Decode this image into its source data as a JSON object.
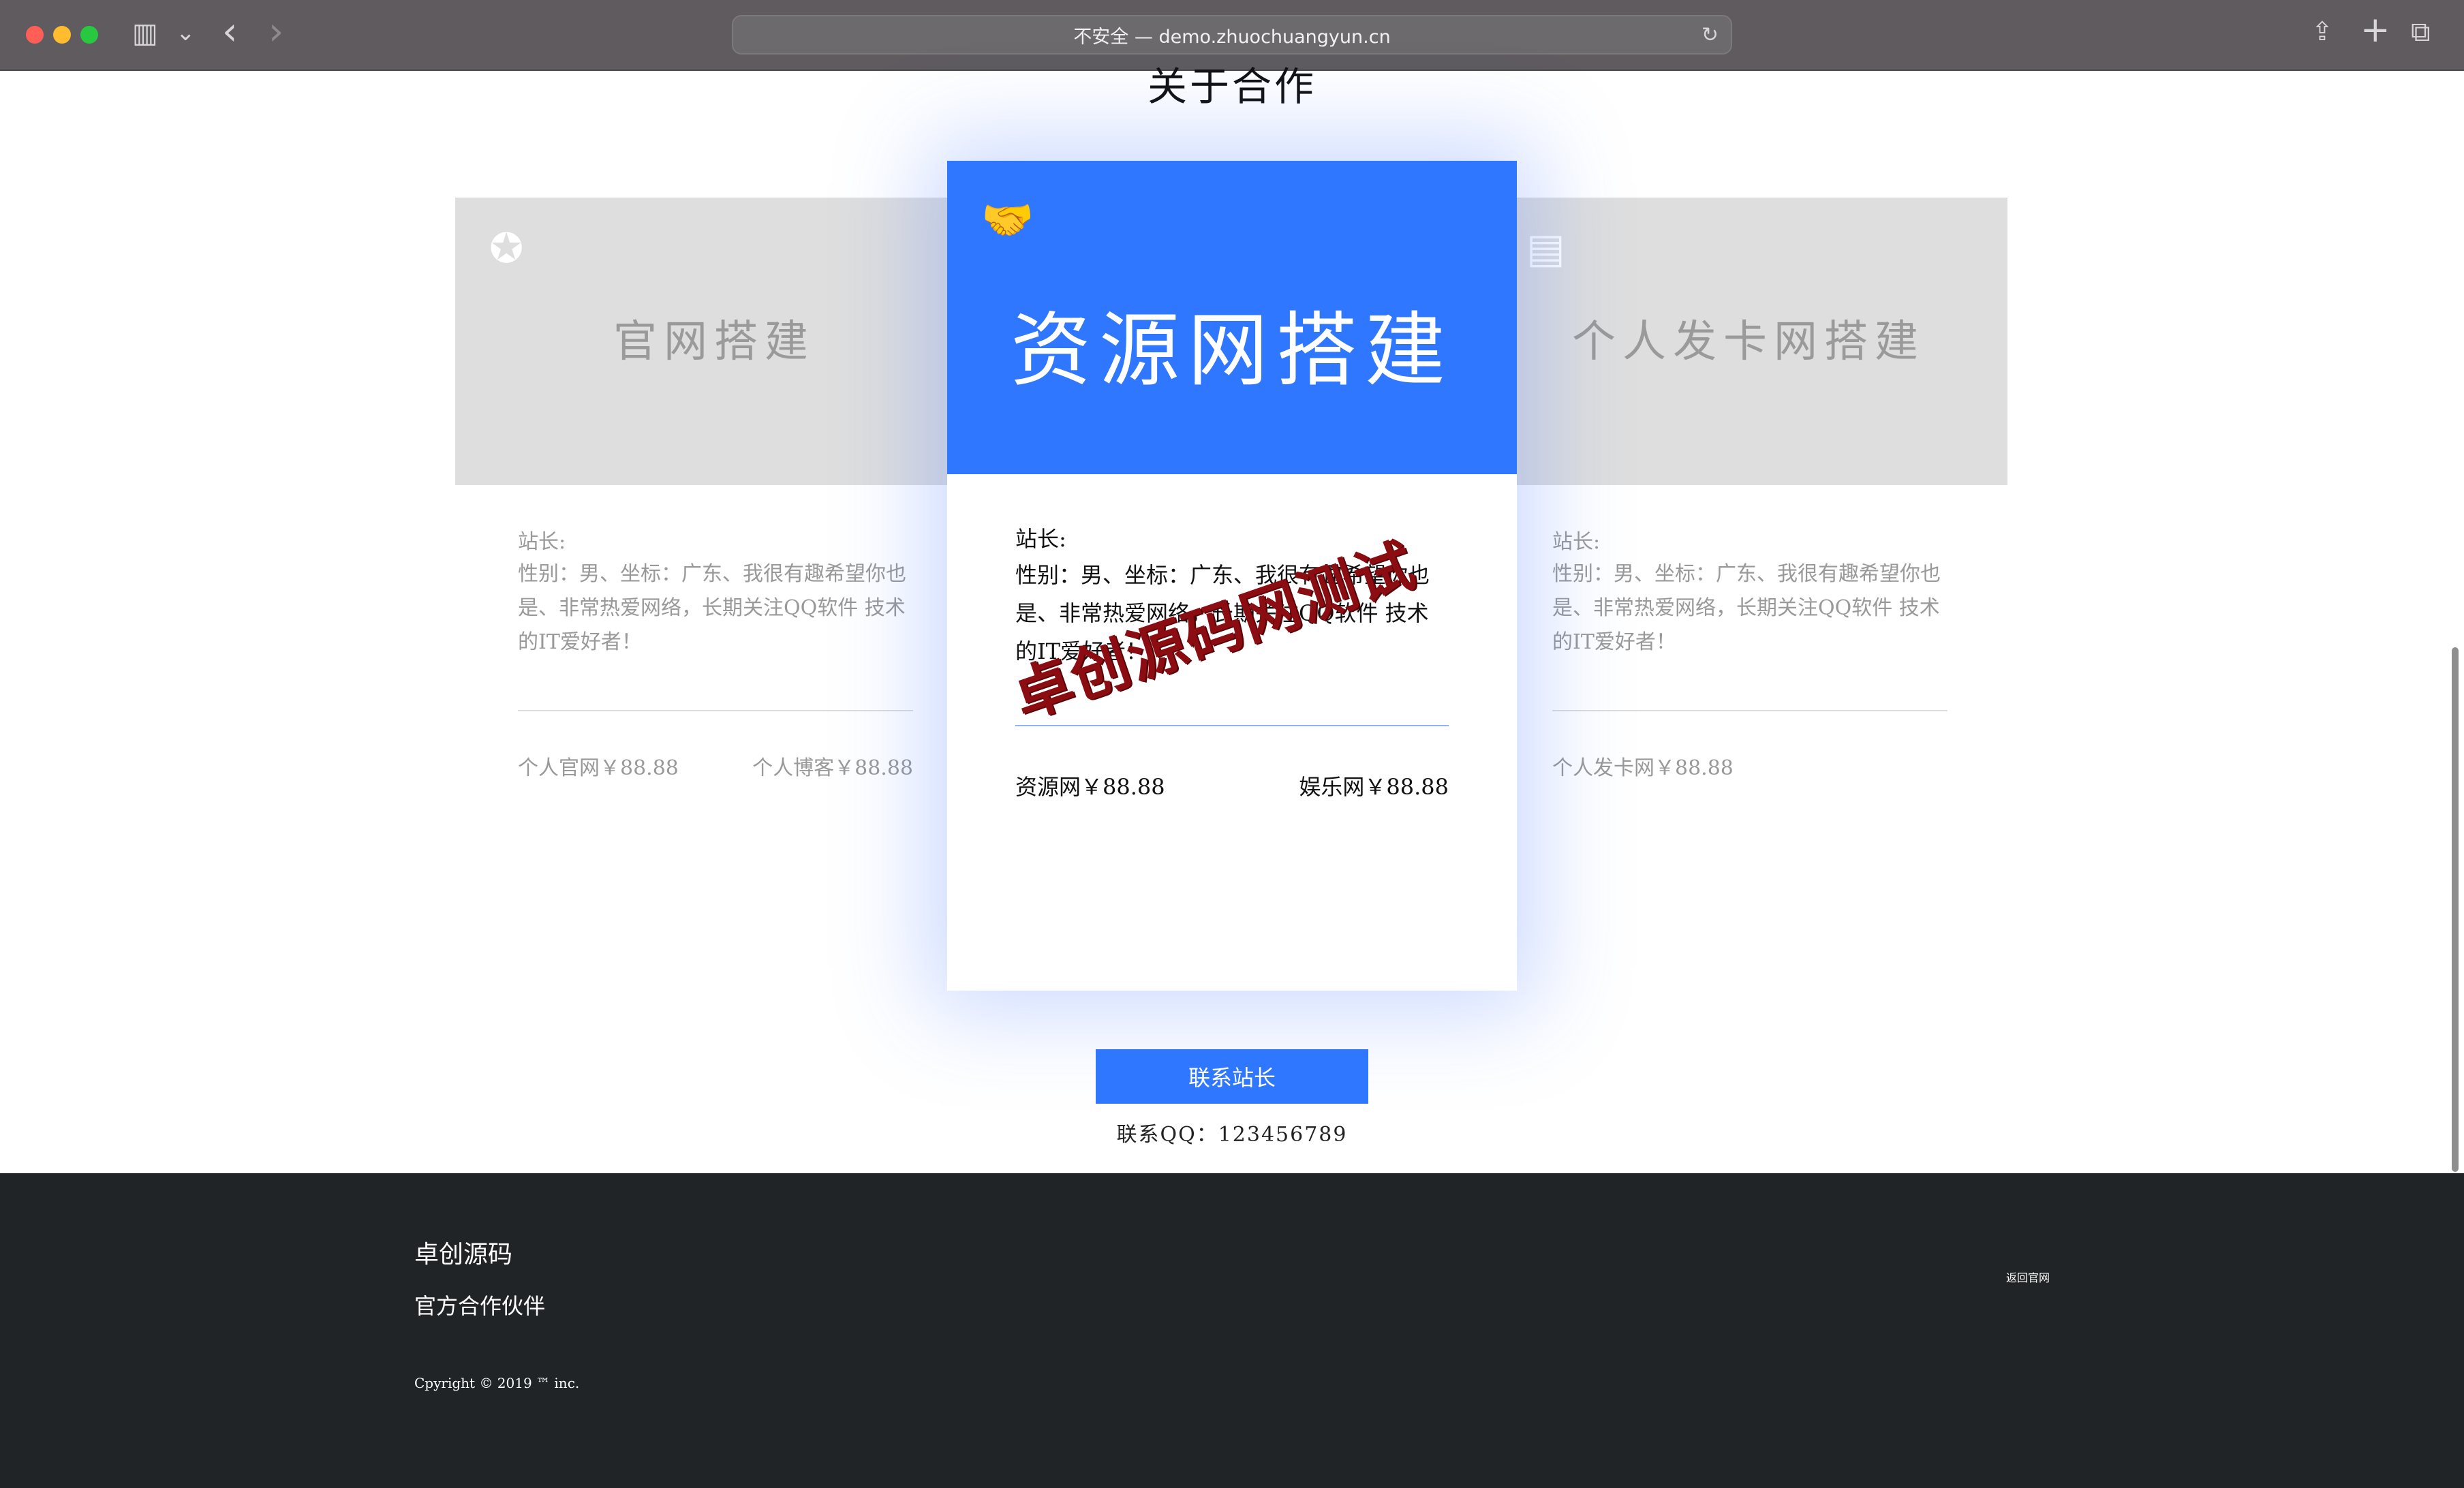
{
  "browser": {
    "url_text": "不安全 — demo.zhuochuangyun.cn",
    "reload_glyph": "↻",
    "sidebar_glyph": "▥",
    "chevron_glyph": "⌄",
    "back_glyph": "‹",
    "forward_glyph": "›",
    "share_glyph": "⇪",
    "newtab_glyph": "+",
    "tabs_glyph": "⧉"
  },
  "section": {
    "title": "关于合作"
  },
  "cards": {
    "left": {
      "icon": "award-icon",
      "icon_glyph": "✪",
      "title": "官网搭建",
      "label": "站长:",
      "desc": "性别：男、坐标：广东、我很有趣希望你也是、非常热爱网络，长期关注QQ软件 技术的IT爱好者！",
      "price1": "个人官网￥88.88",
      "price2": "个人博客￥88.88"
    },
    "center": {
      "icon": "handshake-icon",
      "icon_glyph": "🤝",
      "title": "资源网搭建",
      "label": "站长:",
      "desc": "性别：男、坐标：广东、我很有趣希望你也是、非常热爱网络，长期关注QQ软件 技术的IT爱好者！",
      "price1": "资源网￥88.88",
      "price2": "娱乐网￥88.88"
    },
    "right": {
      "icon": "building-icon",
      "icon_glyph": "▤",
      "title": "个人发卡网搭建",
      "label": "站长:",
      "desc": "性别：男、坐标：广东、我很有趣希望你也是、非常热爱网络，长期关注QQ软件 技术的IT爱好者！",
      "price1": "个人发卡网￥88.88"
    }
  },
  "watermark": "卓创源码网测试",
  "contact": {
    "button": "联系站长",
    "qq": "联系QQ：123456789"
  },
  "footer": {
    "brand": "卓创源码",
    "partner": "官方合作伙伴",
    "copyright": "Cpyright © 2019 ™ inc.",
    "back_link": "返回官网"
  },
  "colors": {
    "accent": "#2f77ff",
    "footer_bg": "#212427",
    "watermark": "#8b0d12"
  }
}
